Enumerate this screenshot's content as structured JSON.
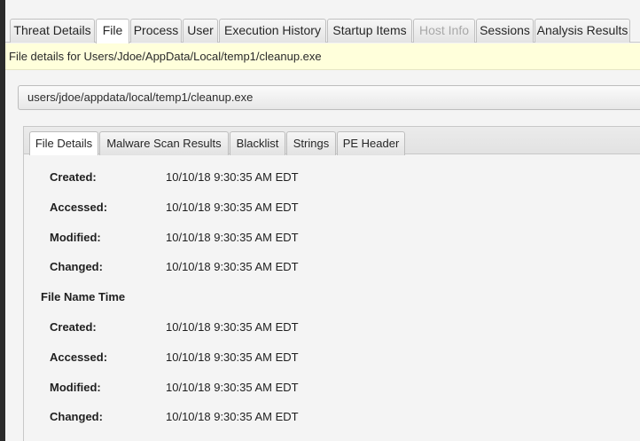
{
  "top_tabs": [
    {
      "label": "Threat Details",
      "state": "normal"
    },
    {
      "label": "File",
      "state": "active"
    },
    {
      "label": "Process",
      "state": "normal"
    },
    {
      "label": "User",
      "state": "normal"
    },
    {
      "label": "Execution History",
      "state": "normal"
    },
    {
      "label": "Startup Items",
      "state": "normal"
    },
    {
      "label": "Host Info",
      "state": "disabled"
    },
    {
      "label": "Sessions",
      "state": "normal"
    },
    {
      "label": "Analysis Results",
      "state": "normal"
    }
  ],
  "info_bar": {
    "text": "File details for Users/Jdoe/AppData/Local/temp1/cleanup.exe"
  },
  "path_box": {
    "value": "users/jdoe/appdata/local/temp1/cleanup.exe"
  },
  "sub_tabs": [
    {
      "label": "File Details",
      "state": "active"
    },
    {
      "label": "Malware Scan Results",
      "state": "normal"
    },
    {
      "label": "Blacklist",
      "state": "normal"
    },
    {
      "label": "Strings",
      "state": "normal"
    },
    {
      "label": "PE Header",
      "state": "normal"
    }
  ],
  "file_details": {
    "times": [
      {
        "label": "Created:",
        "value": "10/10/18 9:30:35 AM EDT"
      },
      {
        "label": "Accessed:",
        "value": "10/10/18 9:30:35 AM EDT"
      },
      {
        "label": "Modified:",
        "value": "10/10/18 9:30:35 AM EDT"
      },
      {
        "label": "Changed:",
        "value": "10/10/18 9:30:35 AM EDT"
      }
    ],
    "file_name_time_heading": "File Name Time",
    "file_name_times": [
      {
        "label": "Created:",
        "value": "10/10/18 9:30:35 AM EDT"
      },
      {
        "label": "Accessed:",
        "value": "10/10/18 9:30:35 AM EDT"
      },
      {
        "label": "Modified:",
        "value": "10/10/18 9:30:35 AM EDT"
      },
      {
        "label": "Changed:",
        "value": "10/10/18 9:30:35 AM EDT"
      }
    ]
  }
}
